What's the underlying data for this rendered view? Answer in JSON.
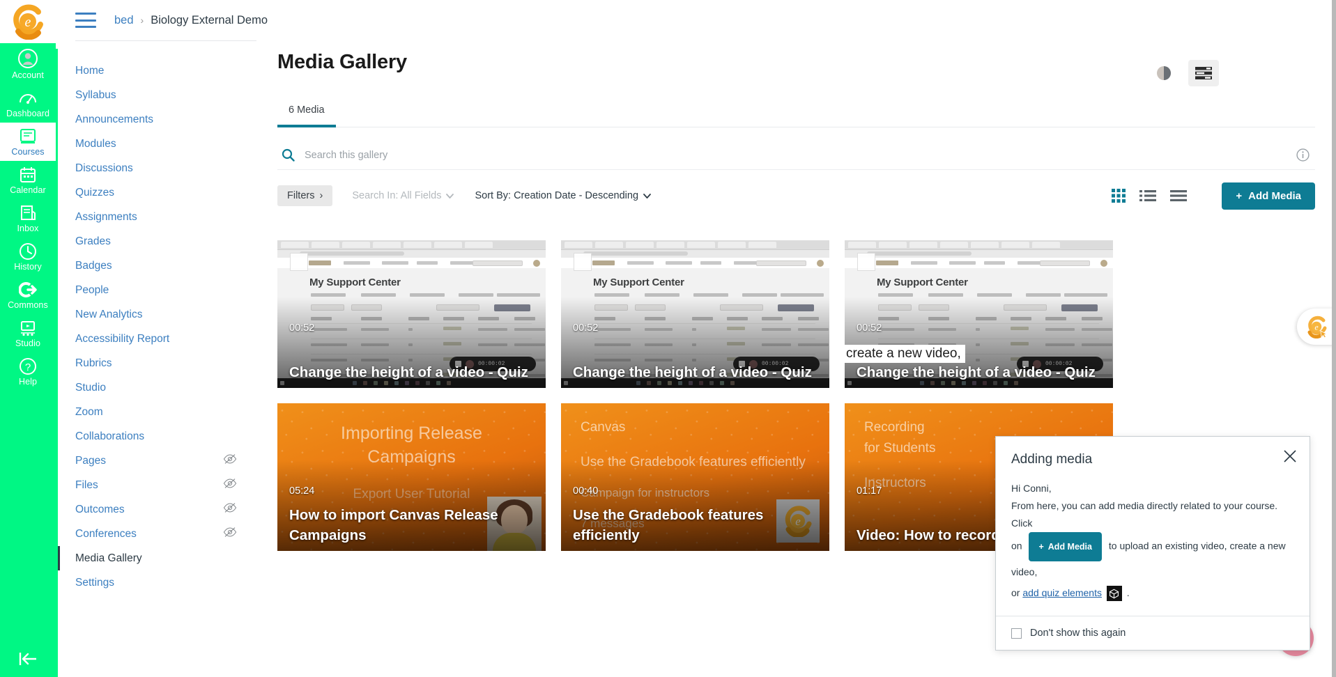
{
  "global_nav": {
    "brand": "eesysoft-logo",
    "items": [
      {
        "label": "Account",
        "icon": "user-circle-icon",
        "active": false
      },
      {
        "label": "Dashboard",
        "icon": "dashboard-icon",
        "active": false
      },
      {
        "label": "Courses",
        "icon": "courses-book-icon",
        "active": true
      },
      {
        "label": "Calendar",
        "icon": "calendar-icon",
        "active": false
      },
      {
        "label": "Inbox",
        "icon": "inbox-icon",
        "active": false
      },
      {
        "label": "History",
        "icon": "clock-icon",
        "active": false
      },
      {
        "label": "Commons",
        "icon": "commons-arrow-icon",
        "active": false
      },
      {
        "label": "Studio",
        "icon": "studio-screen-icon",
        "active": false
      },
      {
        "label": "Help",
        "icon": "question-circle-icon",
        "active": false
      }
    ],
    "collapse_icon": "collapse-left-arrow-icon"
  },
  "topbar": {
    "menu_icon": "hamburger-menu-icon",
    "breadcrumb_root": "bed",
    "breadcrumb_sep": "›",
    "breadcrumb_current": "Biology External Demo"
  },
  "course_nav": {
    "items": [
      {
        "label": "Home",
        "hidden": false,
        "active": false
      },
      {
        "label": "Syllabus",
        "hidden": false,
        "active": false
      },
      {
        "label": "Announcements",
        "hidden": false,
        "active": false
      },
      {
        "label": "Modules",
        "hidden": false,
        "active": false
      },
      {
        "label": "Discussions",
        "hidden": false,
        "active": false
      },
      {
        "label": "Quizzes",
        "hidden": false,
        "active": false
      },
      {
        "label": "Assignments",
        "hidden": false,
        "active": false
      },
      {
        "label": "Grades",
        "hidden": false,
        "active": false
      },
      {
        "label": "Badges",
        "hidden": false,
        "active": false
      },
      {
        "label": "People",
        "hidden": false,
        "active": false
      },
      {
        "label": "New Analytics",
        "hidden": false,
        "active": false
      },
      {
        "label": "Accessibility Report",
        "hidden": false,
        "active": false
      },
      {
        "label": "Rubrics",
        "hidden": false,
        "active": false
      },
      {
        "label": "Studio",
        "hidden": false,
        "active": false
      },
      {
        "label": "Zoom",
        "hidden": false,
        "active": false
      },
      {
        "label": "Collaborations",
        "hidden": false,
        "active": false
      },
      {
        "label": "Pages",
        "hidden": true,
        "active": false
      },
      {
        "label": "Files",
        "hidden": true,
        "active": false
      },
      {
        "label": "Outcomes",
        "hidden": true,
        "active": false
      },
      {
        "label": "Conferences",
        "hidden": true,
        "active": false
      },
      {
        "label": "Media Gallery",
        "hidden": false,
        "active": true
      },
      {
        "label": "Settings",
        "hidden": false,
        "active": false
      }
    ]
  },
  "main": {
    "page_title": "Media Gallery",
    "contrast_icon": "contrast-toggle-icon",
    "settings_icon": "sliders-settings-icon",
    "tabs": [
      {
        "label": "6 Media",
        "active": true
      }
    ],
    "search": {
      "icon": "search-icon",
      "placeholder": "Search this gallery",
      "value": "",
      "info_icon": "info-circle-icon"
    },
    "controls": {
      "filters_label": "Filters",
      "filters_chevron": "›",
      "search_in_label": "Search In: All Fields",
      "sort_by_label": "Sort By: Creation Date - Descending",
      "chevron_down": "⌄",
      "views": [
        {
          "name": "grid-view-icon",
          "active": true
        },
        {
          "name": "detail-list-view-icon",
          "active": false
        },
        {
          "name": "compact-list-view-icon",
          "active": false
        }
      ],
      "add_media_label": "Add Media",
      "add_media_plus": "+",
      "accent_color": "#0e7c94"
    },
    "media_items": [
      {
        "thumb": "browser-screenshot",
        "duration": "00:52",
        "title": "Change the height of a video - Quiz",
        "overlay_heading": "My Support Center",
        "rec_time": "00:00:02"
      },
      {
        "thumb": "browser-screenshot",
        "duration": "00:52",
        "title": "Change the height of a video - Quiz",
        "overlay_heading": "My Support Center",
        "rec_time": "00:00:02"
      },
      {
        "thumb": "browser-screenshot",
        "duration": "00:52",
        "title": "Change the height of a video - Quiz",
        "overlay_heading": "My Support Center",
        "rec_time": "00:00:02"
      },
      {
        "thumb": "orange-centered",
        "duration": "05:24",
        "title": "How to import Canvas Release Campaigns",
        "overlay_heading": "Importing Release Campaigns",
        "overlay_sub": "Export User Tutorial",
        "decoration": "presenter-portrait"
      },
      {
        "thumb": "orange-left",
        "duration": "00:40",
        "title": "Use the Gradebook features efficiently",
        "overlay_heading": "Canvas",
        "overlay_sub": "Use the Gradebook features efficiently",
        "overlay_sub2": "Campaign for instructors",
        "overlay_sub3": "7 messages",
        "decoration": "eesysoft-logo-badge"
      },
      {
        "thumb": "orange-left",
        "duration": "01:17",
        "title": "Video: How to record a video/audio",
        "overlay_heading": "Recording",
        "overlay_heading2": "for Students",
        "overlay_sub": "Instructors"
      }
    ],
    "tooltip_text": "create a new video,"
  },
  "popover": {
    "title": "Adding media",
    "close_icon": "close-x-icon",
    "greeting": "Hi Conni,",
    "body_before": "From here, you can add media directly related to your course. Click",
    "on_word": "on",
    "add_media_chip": "Add Media",
    "add_media_plus": "+",
    "mid_text": "to upload an existing video,  create a new video,",
    "or_word": "or",
    "quiz_link": "add quiz elements",
    "quiz_icon": "cube-quiz-icon",
    "period": ".",
    "dont_show_label": "Don't show this again",
    "dont_show_checked": false
  },
  "widgets": {
    "studio_tab_icon": "eesysoft-pointer-icon",
    "help_fab_icon": "question-mark-icon",
    "help_fab_color": "#e3879c"
  }
}
